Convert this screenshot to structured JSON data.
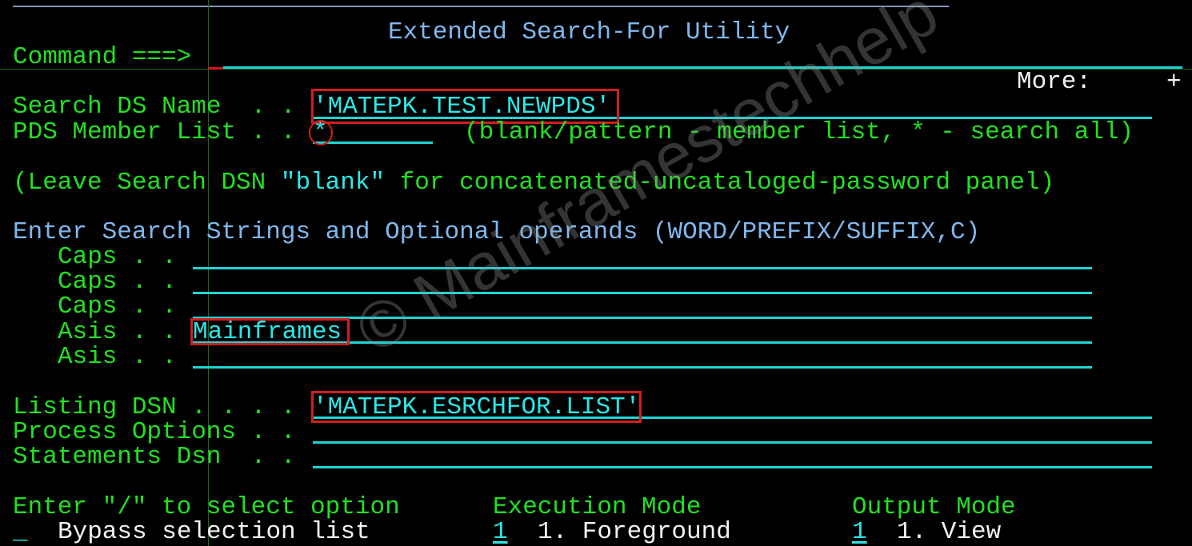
{
  "panel": {
    "title": "Extended Search-For Utility",
    "command_label": "Command ===>",
    "command_value": "",
    "more_label": "More:",
    "more_indicator": "+"
  },
  "search_ds": {
    "label": "Search DS Name  . .",
    "value": "'MATEPK.TEST.NEWPDS'"
  },
  "member_list": {
    "label": "PDS Member List . .",
    "value": "*",
    "hint": "(blank/pattern - member list, * - search all)"
  },
  "leave_note": {
    "prefix": "(Leave Search DSN ",
    "highlight": "\"blank\"",
    "suffix": " for concatenated-uncataloged-password panel)"
  },
  "search_strings": {
    "heading": "Enter Search Strings and Optional operands (WORD/PREFIX/SUFFIX,C)",
    "rows": [
      {
        "label": "Caps . .",
        "value": ""
      },
      {
        "label": "Caps . .",
        "value": ""
      },
      {
        "label": "Caps . .",
        "value": ""
      },
      {
        "label": "Asis . .",
        "value": "Mainframes"
      },
      {
        "label": "Asis . .",
        "value": ""
      }
    ]
  },
  "listing_dsn": {
    "label": "Listing DSN . . . .",
    "value": "'MATEPK.ESRCHFOR.LIST'"
  },
  "process_options": {
    "label": "Process Options . .",
    "value": ""
  },
  "statements_dsn": {
    "label": "Statements Dsn  . .",
    "value": ""
  },
  "select_option": {
    "heading": "Enter \"/\" to select option",
    "value": "_",
    "label": "Bypass selection list"
  },
  "execution_mode": {
    "heading": "Execution Mode",
    "value": "1",
    "option": "1. Foreground"
  },
  "output_mode": {
    "heading": "Output Mode",
    "value": "1",
    "option": "1. View"
  },
  "watermark": "© Mainframestechhelp",
  "colors": {
    "label_green": "#22e022",
    "heading_blue": "#7fb8ee",
    "input_cyan": "#2ae8e8",
    "highlight_red": "#d01e1e",
    "background": "#000000"
  }
}
